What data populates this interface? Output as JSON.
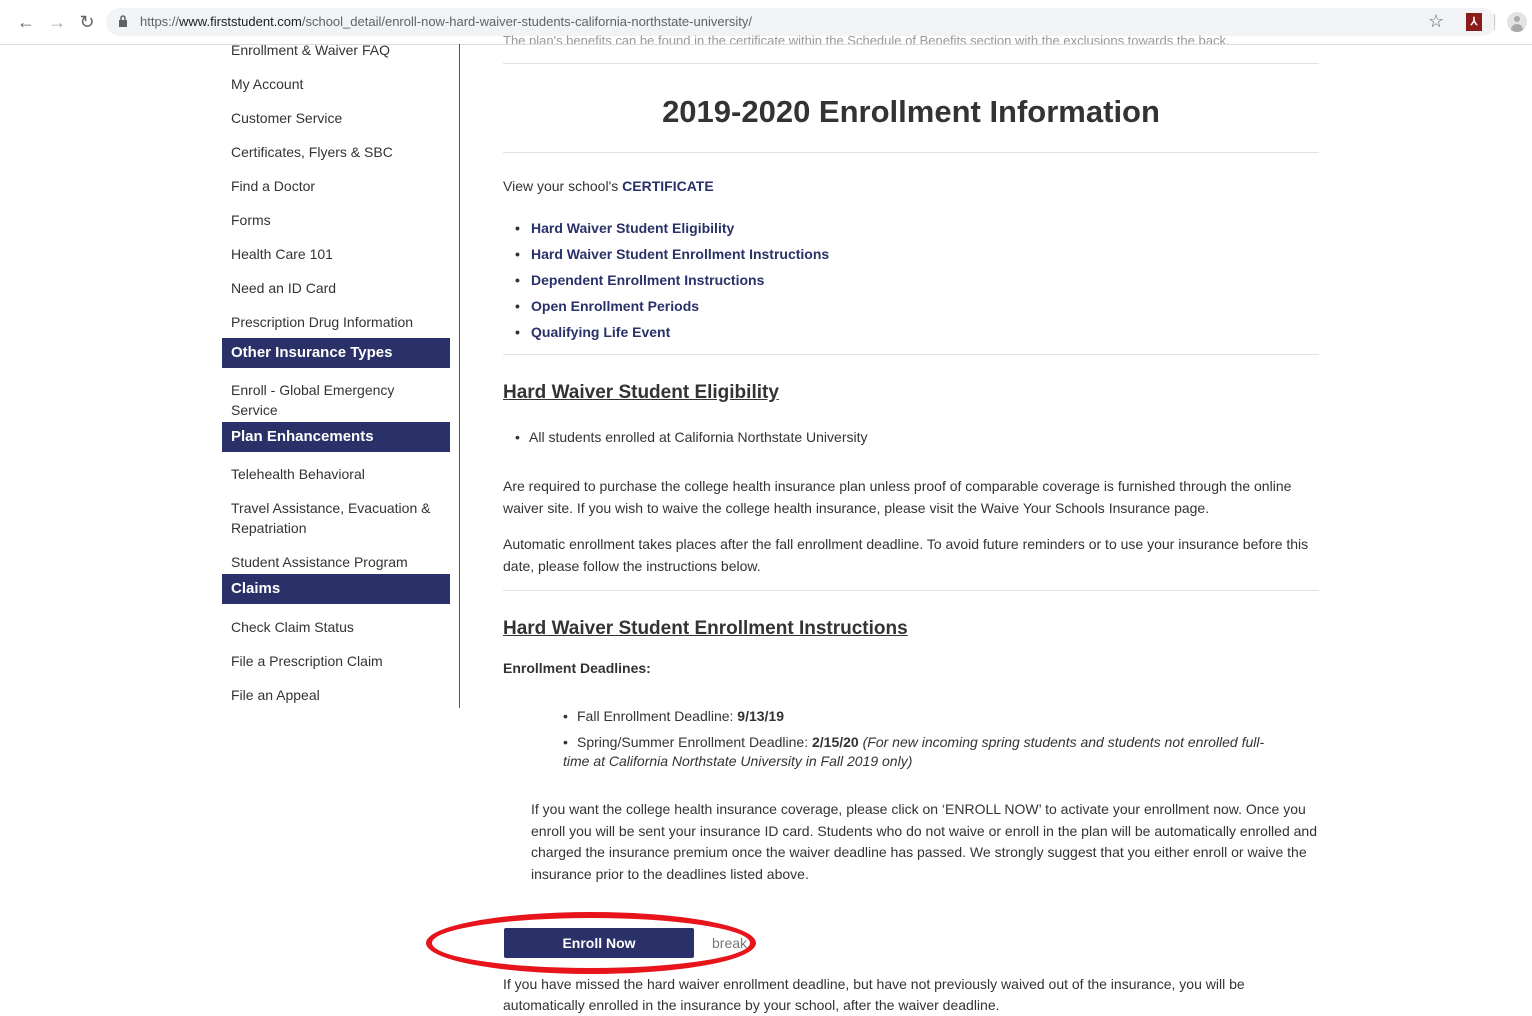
{
  "browser": {
    "url_scheme": "https://",
    "url_host": "www.firststudent.com",
    "url_path": "/school_detail/enroll-now-hard-waiver-students-california-northstate-university/"
  },
  "sidebar": {
    "items": [
      {
        "type": "link",
        "label": "Enrollment & Waiver FAQ"
      },
      {
        "type": "link",
        "label": "My Account"
      },
      {
        "type": "link",
        "label": "Customer Service"
      },
      {
        "type": "link",
        "label": "Certificates, Flyers & SBC"
      },
      {
        "type": "link",
        "label": "Find a Doctor"
      },
      {
        "type": "link",
        "label": "Forms"
      },
      {
        "type": "link",
        "label": "Health Care 101"
      },
      {
        "type": "link",
        "label": "Need an ID Card"
      },
      {
        "type": "link",
        "label": "Prescription Drug Information"
      },
      {
        "type": "header",
        "label": "Other Insurance Types"
      },
      {
        "type": "link",
        "label": "Enroll - Global Emergency Service"
      },
      {
        "type": "header",
        "label": "Plan Enhancements"
      },
      {
        "type": "link",
        "label": "Telehealth Behavioral"
      },
      {
        "type": "link",
        "label": "Travel Assistance, Evacuation & Repatriation"
      },
      {
        "type": "link",
        "label": "Student Assistance Program"
      },
      {
        "type": "header",
        "label": "Claims"
      },
      {
        "type": "link",
        "label": "Check Claim Status"
      },
      {
        "type": "link",
        "label": "File a Prescription Claim"
      },
      {
        "type": "link",
        "label": "File an Appeal"
      }
    ]
  },
  "main": {
    "cut_off_line": "The plan's benefits can be found in the certificate within the Schedule of Benefits section with the exclusions towards the back.",
    "title": "2019-2020 Enrollment Information",
    "intro_prefix": "View your school's ",
    "intro_link": "CERTIFICATE",
    "quick_links": [
      "Hard Waiver Student Eligibility",
      "Hard Waiver Student Enrollment Instructions",
      "Dependent Enrollment Instructions",
      "Open Enrollment Periods",
      "Qualifying Life Event"
    ],
    "eligibility": {
      "heading": "Hard Waiver Student Eligibility",
      "bullet": "All students enrolled at California Northstate University",
      "para1": "Are required to purchase the college health insurance plan unless proof of comparable coverage is furnished through the online waiver site. If you wish to waive the college health insurance, please visit the Waive Your Schools Insurance page.",
      "para2": "Automatic enrollment takes places after the fall enrollment deadline. To avoid future reminders or to use your insurance before this date, please follow the instructions below."
    },
    "instructions": {
      "heading": "Hard Waiver Student Enrollment Instructions",
      "deadlines_label": "Enrollment Deadlines:",
      "fall_label": "Fall Enrollment Deadline: ",
      "fall_date": "9/13/19",
      "spring_label": "Spring/Summer Enrollment Deadline: ",
      "spring_date": "2/15/20",
      "spring_note": "(For new incoming spring students and students not enrolled full-time at California Northstate University in Fall 2019 only)",
      "para": "If you want the college health insurance coverage, please click on ‘ENROLL NOW’ to activate your enrollment now. Once you enroll you will be sent your insurance ID card. Students who do not waive or enroll in the plan will be automatically enrolled and charged the insurance premium once the waiver deadline has passed. We strongly suggest that you either enroll or waive the insurance prior to the deadlines listed above.",
      "enroll_button": "Enroll Now",
      "break_text": "break",
      "bottom_para": "If you have missed the hard waiver enrollment deadline, but have not previously waived out of the insurance, you will be automatically enrolled in the insurance by your school, after the waiver deadline."
    }
  },
  "annotation_color": "#e8141b"
}
